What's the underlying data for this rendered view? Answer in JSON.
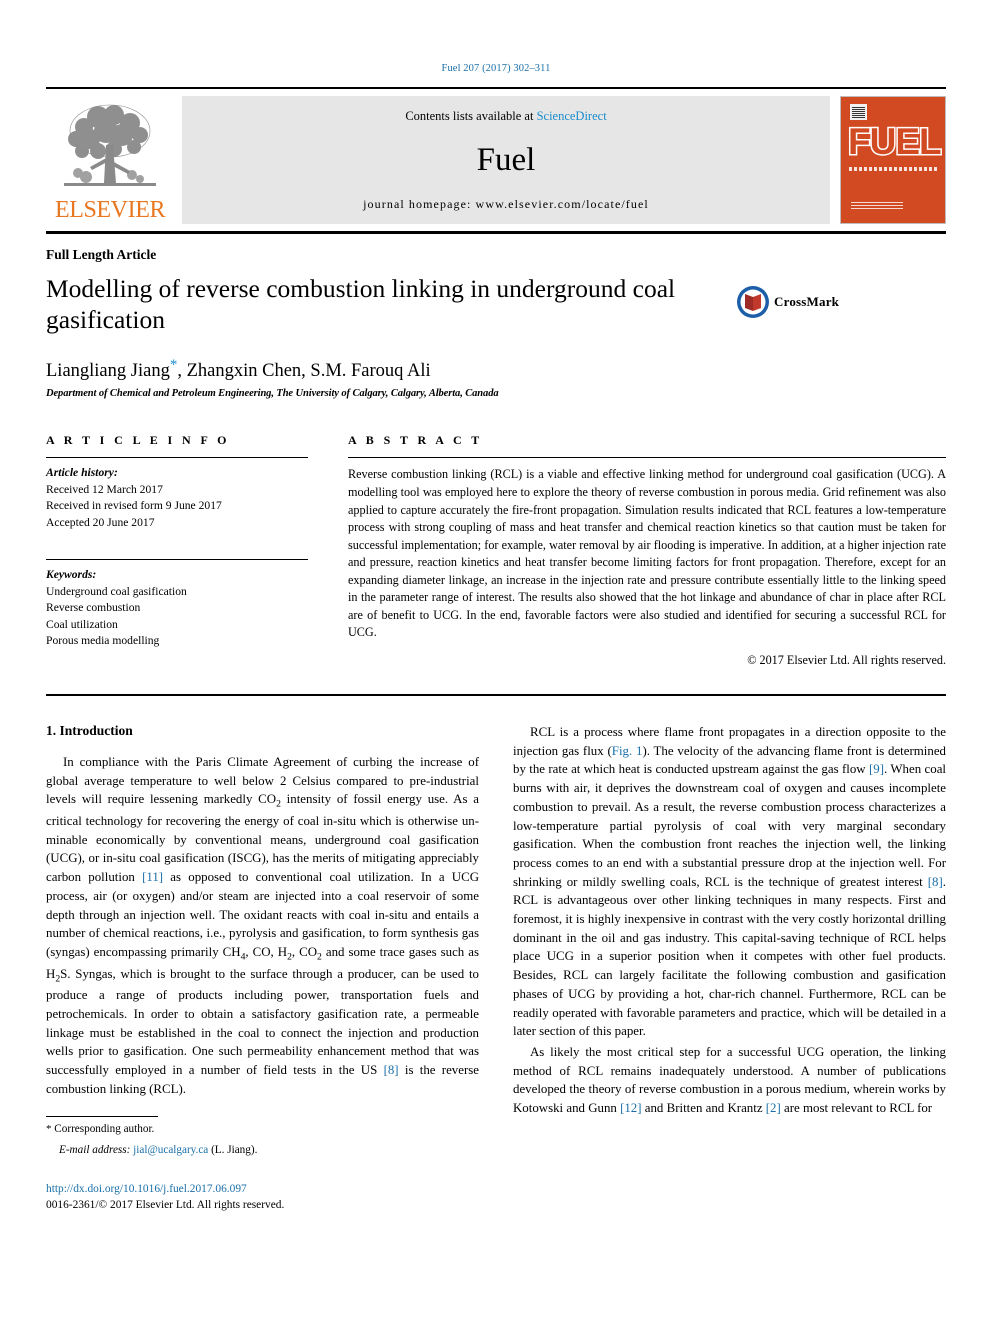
{
  "running_head": "Fuel 207 (2017) 302–311",
  "masthead": {
    "contents_prefix": "Contents lists available at ",
    "sciencedirect": "ScienceDirect",
    "journal_title": "Fuel",
    "homepage": "journal homepage: www.elsevier.com/locate/fuel",
    "publisher_wordmark": "ELSEVIER",
    "cover_title": "FUEL",
    "accent_orange": "#E87722",
    "cover_orange": "#D14A22",
    "link_blue": "#1a8ccc"
  },
  "article": {
    "type": "Full Length Article",
    "title": "Modelling of reverse combustion linking in underground coal gasification",
    "crossmark_label": "CrossMark",
    "authors": "Liangliang Jiang",
    "authors_rest": ", Zhangxin Chen, S.M. Farouq Ali",
    "corresponding_marker": "*",
    "affiliation": "Department of Chemical and Petroleum Engineering, The University of Calgary, Calgary, Alberta, Canada"
  },
  "article_info": {
    "heading": "A R T I C L E   I N F O",
    "history_label": "Article history:",
    "history": [
      "Received 12 March 2017",
      "Received in revised form 9 June 2017",
      "Accepted 20 June 2017"
    ],
    "keywords_label": "Keywords:",
    "keywords": [
      "Underground coal gasification",
      "Reverse combustion",
      "Coal utilization",
      "Porous media modelling"
    ]
  },
  "abstract": {
    "heading": "A B S T R A C T",
    "text": "Reverse combustion linking (RCL) is a viable and effective linking method for underground coal gasification (UCG). A modelling tool was employed here to explore the theory of reverse combustion in porous media. Grid refinement was also applied to capture accurately the fire-front propagation. Simulation results indicated that RCL features a low-temperature process with strong coupling of mass and heat transfer and chemical reaction kinetics so that caution must be taken for successful implementation; for example, water removal by air flooding is imperative. In addition, at a higher injection rate and pressure, reaction kinetics and heat transfer become limiting factors for front propagation. Therefore, except for an expanding diameter linkage, an increase in the injection rate and pressure contribute essentially little to the linking speed in the parameter range of interest. The results also showed that the hot linkage and abundance of char in place after RCL are of benefit to UCG. In the end, favorable factors were also studied and identified for securing a successful RCL for UCG.",
    "copyright": "© 2017 Elsevier Ltd. All rights reserved."
  },
  "introduction": {
    "heading": "1. Introduction",
    "left_para_1_a": "In compliance with the Paris Climate Agreement of curbing the increase of global average temperature to well below 2 Celsius compared to pre-industrial levels will require lessening markedly CO",
    "left_para_1_b": " intensity of fossil energy use. As a critical technology for recovering the energy of coal in-situ which is otherwise un-minable economically by conventional means, underground coal gasification (UCG), or in-situ coal gasification (ISCG), has the merits of mitigating appreciably carbon pollution ",
    "ref_11": "[11]",
    "left_para_1_c": " as opposed to conventional coal utilization. In a UCG process, air (or oxygen) and/or steam are injected into a coal reservoir of some depth through an injection well. The oxidant reacts with coal in-situ and entails a number of chemical reactions, i.e., pyrolysis and gasification, to form synthesis gas (syngas) encompassing primarily CH",
    "left_para_1_d": ", CO, H",
    "left_para_1_e": ", CO",
    "left_para_1_f": " and some trace gases such as H",
    "left_para_1_g": "S. Syngas, which is brought to the surface through a producer, can be used to produce a range of products including power, transportation fuels and petrochemicals. In order to obtain a satisfactory gasification rate, a permeable linkage must be established in the coal to connect the injection and production wells prior to gasification. One such permeability enhancement method that was successfully employed in a number of field tests in the US ",
    "ref_8_left": "[8]",
    "left_para_1_h": " is the reverse combustion linking (RCL).",
    "sub_4": "4",
    "sub_2": "2",
    "right_para_1_a": "RCL is a process where flame front propagates in a direction opposite to the injection gas flux (",
    "fig_1": "Fig. 1",
    "right_para_1_b": "). The velocity of the advancing flame front is determined by the rate at which heat is conducted upstream against the gas flow ",
    "ref_9": "[9]",
    "right_para_1_c": ". When coal burns with air, it deprives the downstream coal of oxygen and causes incomplete combustion to prevail. As a result, the reverse combustion process characterizes a low-temperature partial pyrolysis of coal with very marginal secondary gasification. When the combustion front reaches the injection well, the linking process comes to an end with a substantial pressure drop at the injection well. For shrinking or mildly swelling coals, RCL is the technique of greatest interest ",
    "ref_8_right": "[8]",
    "right_para_1_d": ". RCL is advantageous over other linking techniques in many respects. First and foremost, it is highly inexpensive in contrast with the very costly horizontal drilling dominant in the oil and gas industry. This capital-saving technique of RCL helps place UCG in a superior position when it competes with other fuel products. Besides, RCL can largely facilitate the following combustion and gasification phases of UCG by providing a hot, char-rich channel. Furthermore, RCL can be readily operated with favorable parameters and practice, which will be detailed in a later section of this paper.",
    "right_para_2_a": "As likely the most critical step for a successful UCG operation, the linking method of RCL remains inadequately understood. A number of publications developed the theory of reverse combustion in a porous medium, wherein works by Kotowski and Gunn ",
    "ref_12": "[12]",
    "right_para_2_b": " and Britten and Krantz ",
    "ref_2": "[2]",
    "right_para_2_c": " are most relevant to RCL for"
  },
  "footer": {
    "corresponding_marker": "*",
    "corresponding_label": " Corresponding author.",
    "email_label": "E-mail address:",
    "email": "jial@ucalgary.ca",
    "email_suffix": " (L. Jiang).",
    "doi": "http://dx.doi.org/10.1016/j.fuel.2017.06.097",
    "issn_line": "0016-2361/© 2017 Elsevier Ltd. All rights reserved."
  }
}
